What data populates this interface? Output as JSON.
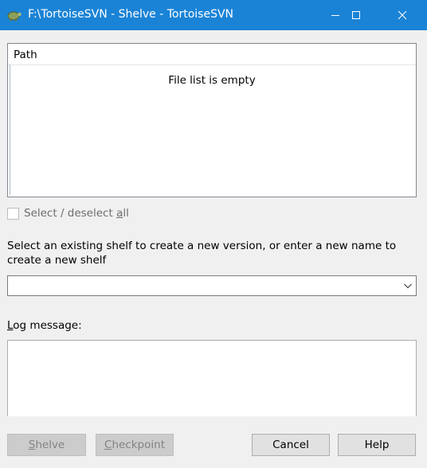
{
  "window": {
    "title": "F:\\TortoiseSVN - Shelve - TortoiseSVN"
  },
  "file_list": {
    "column_header": "Path",
    "empty_message": "File list is empty"
  },
  "select_all": {
    "label_before": "Select / deselect ",
    "label_accel": "a",
    "label_after": "ll",
    "checked": false,
    "enabled": false
  },
  "instructions": "Select an existing shelf to create a new version, or enter a new name to create a new shelf",
  "shelf_combo": {
    "value": ""
  },
  "log_message": {
    "label_accel": "L",
    "label_rest": "og message:",
    "value": ""
  },
  "buttons": {
    "shelve": {
      "accel": "S",
      "rest": "helve",
      "enabled": false
    },
    "checkpoint": {
      "accel": "C",
      "rest": "heckpoint",
      "enabled": false
    },
    "cancel": {
      "label": "Cancel"
    },
    "help": {
      "label": "Help"
    }
  },
  "colors": {
    "titlebar": "#1a83d6",
    "background": "#f0f0f0"
  }
}
